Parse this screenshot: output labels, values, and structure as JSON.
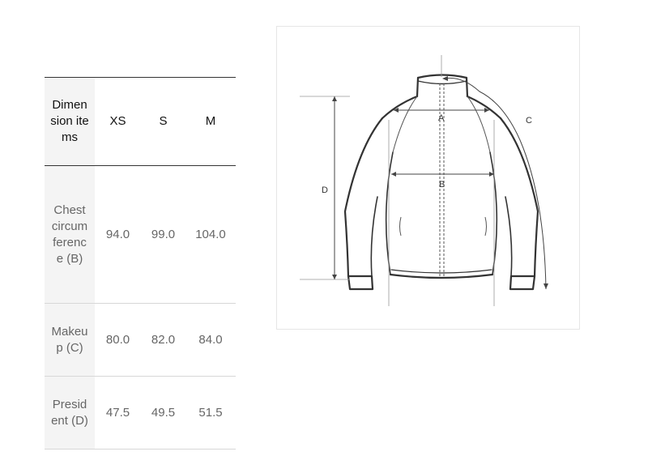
{
  "size_table": {
    "header": {
      "dimension": "Dimension items",
      "sizes": [
        "XS",
        "S",
        "M"
      ]
    },
    "rows": [
      {
        "label": "Chest circumference (B)",
        "values": [
          "94.0",
          "99.0",
          "104.0"
        ]
      },
      {
        "label": "Makeup (C)",
        "values": [
          "80.0",
          "82.0",
          "84.0"
        ]
      },
      {
        "label": "President (D)",
        "values": [
          "47.5",
          "49.5",
          "51.5"
        ]
      }
    ]
  },
  "diagram": {
    "labels": {
      "a": "A",
      "b": "B",
      "c": "C",
      "d": "D"
    },
    "colors": {
      "line": "#333333",
      "guide": "#999999",
      "frame": "#e6e6e6"
    }
  }
}
